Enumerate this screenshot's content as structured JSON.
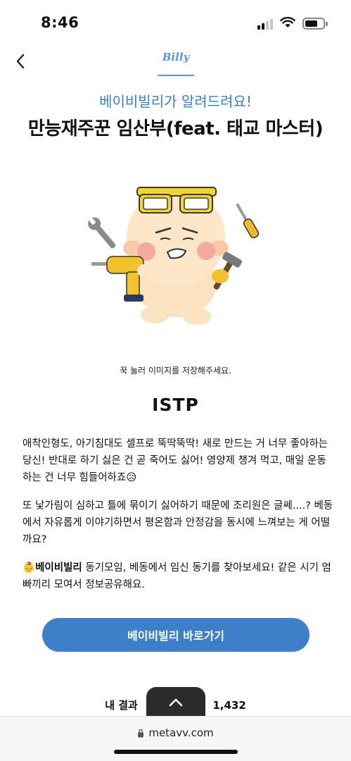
{
  "status_bar": {
    "time": "8:46"
  },
  "header": {
    "logo_text": "Billy"
  },
  "subtitle": "베이비빌리가 알려드려요!",
  "title": "만능재주꾼 임산부(feat. 태교 마스터)",
  "save_hint": "꾹 눌러 이미지를 저장해주세요.",
  "mbti": "ISTP",
  "description": {
    "p1": "애착인형도, 아기침대도 셀프로 뚝딱뚝딱! 새로 만드는 거 너무 좋아하는 당신! 반대로 하기 싫은 건 곧 죽어도 싫어! 영양제 챙겨 먹고, 매일 운동하는 건 너무 힘들어하죠😥",
    "p2": "또 낯가림이 심하고 틀에 묶이기 싫어하기 때문에 조리원은 글쎄....? 베동에서 자유롭게 이야기하면서 평온함과 안정감을 동시에 느껴보는 게 어떨까요?",
    "p3_emoji": "👶",
    "p3_bold": "베이비빌리",
    "p3_rest": " 동기모임, 베동에서 임신 동기를 찾아보세요! 같은 시기 엄빠끼리 모여서 정보공유해요."
  },
  "cta_label": "베이비빌리 바로가기",
  "result_count": {
    "label": "내 결과",
    "value": "1,432"
  },
  "browser": {
    "url": "metavv.com"
  },
  "colors": {
    "accent": "#3d7fc9",
    "subtitle": "#3a80cf",
    "logo": "#5a96dc"
  },
  "icons": [
    "back-chevron-icon",
    "cellular-signal-icon",
    "wifi-icon",
    "battery-icon",
    "chevron-up-icon",
    "lock-icon"
  ]
}
